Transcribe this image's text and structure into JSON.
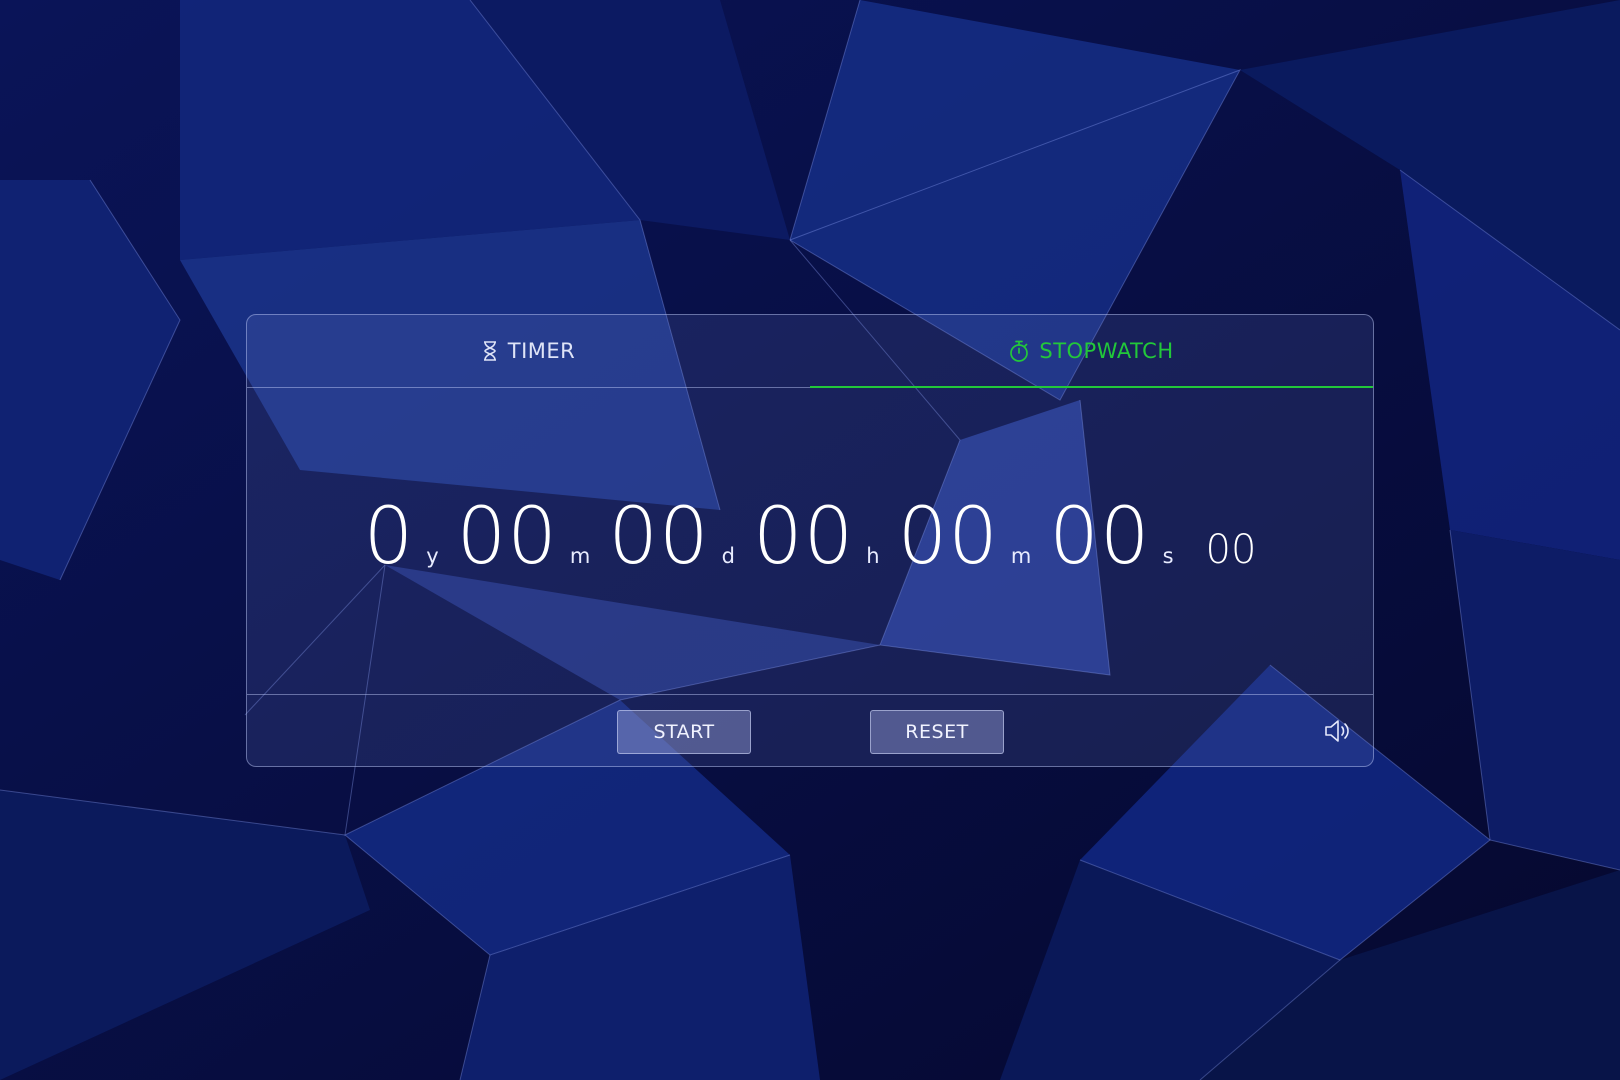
{
  "tabs": [
    {
      "label": "TIMER",
      "icon": "hourglass-icon",
      "active": false
    },
    {
      "label": "STOPWATCH",
      "icon": "stopwatch-icon",
      "active": true
    }
  ],
  "display": {
    "years": "0",
    "years_unit": "y",
    "months": "00",
    "months_unit": "m",
    "days": "00",
    "days_unit": "d",
    "hours": "00",
    "hours_unit": "h",
    "minutes": "00",
    "minutes_unit": "m",
    "seconds": "00",
    "seconds_unit": "s",
    "centiseconds": "00"
  },
  "controls": {
    "start_label": "START",
    "reset_label": "RESET",
    "sound_icon": "speaker-icon"
  },
  "colors": {
    "accent": "#22c83a",
    "background": "#0b1450",
    "text": "#ffffff"
  }
}
